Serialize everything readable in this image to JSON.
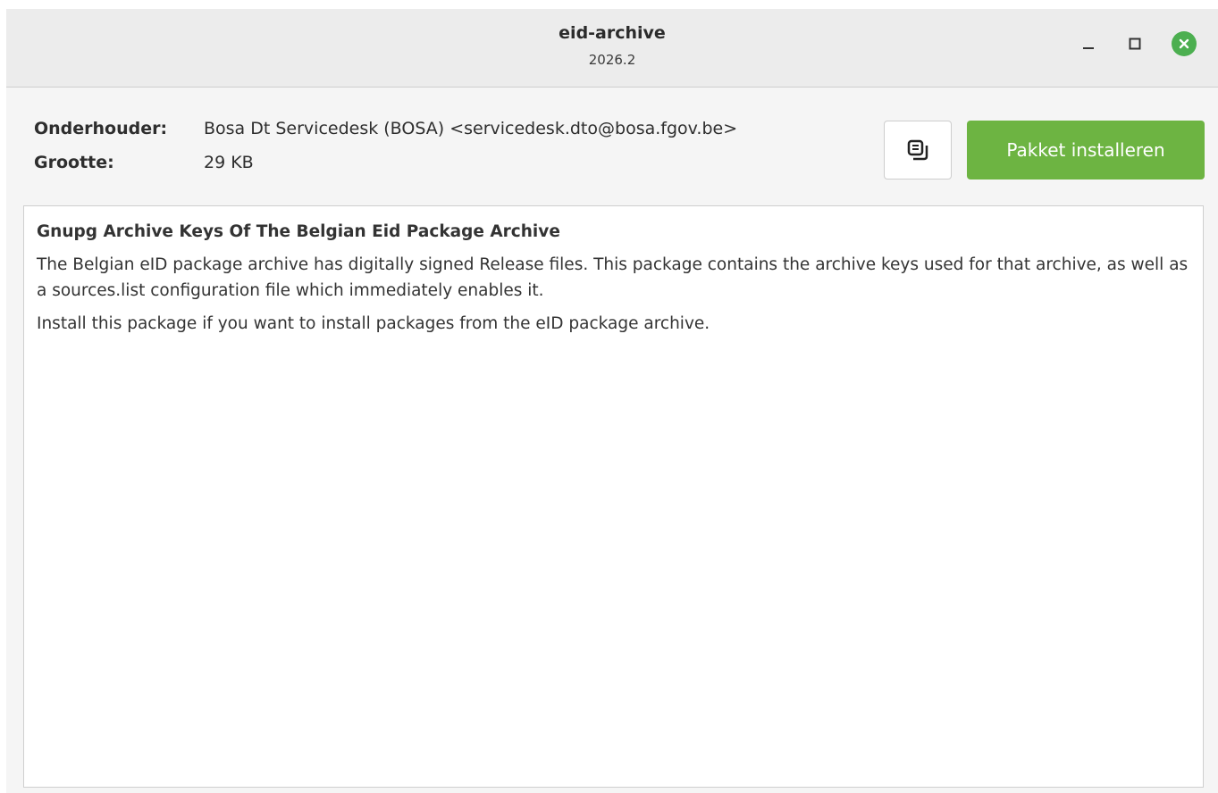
{
  "window": {
    "title": "eid-archive",
    "subtitle": "2026.2"
  },
  "controls": {
    "minimize_icon": "minimize-icon",
    "maximize_icon": "maximize-icon",
    "close_icon": "close-icon",
    "close_color": "#4caf50"
  },
  "info": {
    "maintainer_label": "Onderhouder:",
    "maintainer_value": "Bosa Dt Servicedesk (BOSA) <servicedesk.dto@bosa.fgov.be>",
    "size_label": "Grootte:",
    "size_value": "29 KB"
  },
  "actions": {
    "copy_icon": "copy-icon",
    "install_label": "Pakket installeren",
    "install_color": "#6db442"
  },
  "description": {
    "title": "Gnupg Archive Keys Of The Belgian Eid Package Archive",
    "paragraphs": [
      "The Belgian eID package archive has digitally signed Release files. This package contains the archive keys used for that archive, as well as a sources.list configuration file which immediately enables it.",
      "Install this package if you want to install packages from the eID package archive."
    ]
  }
}
